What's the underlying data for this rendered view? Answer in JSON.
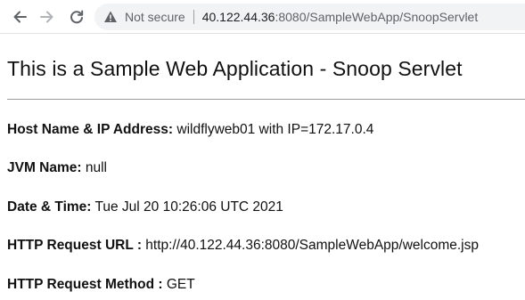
{
  "browser": {
    "security_label": "Not secure",
    "url_host": "40.122.44.36",
    "url_rest": ":8080/SampleWebApp/SnoopServlet",
    "icons": {
      "back": "back-arrow-icon",
      "forward": "forward-arrow-icon",
      "reload": "reload-icon",
      "warning": "warning-triangle-icon"
    }
  },
  "page": {
    "title": "This is a Sample Web Application - Snoop Servlet",
    "fields": [
      {
        "label": "Host Name & IP Address:",
        "value": " wildflyweb01 with IP=172.17.0.4"
      },
      {
        "label": "JVM Name:",
        "value": " null"
      },
      {
        "label": "Date & Time:",
        "value": " Tue Jul 20 10:26:06 UTC 2021"
      },
      {
        "label": "HTTP Request URL :",
        "value": " http://40.122.44.36:8080/SampleWebApp/welcome.jsp"
      },
      {
        "label": "HTTP Request Method :",
        "value": " GET"
      }
    ]
  }
}
